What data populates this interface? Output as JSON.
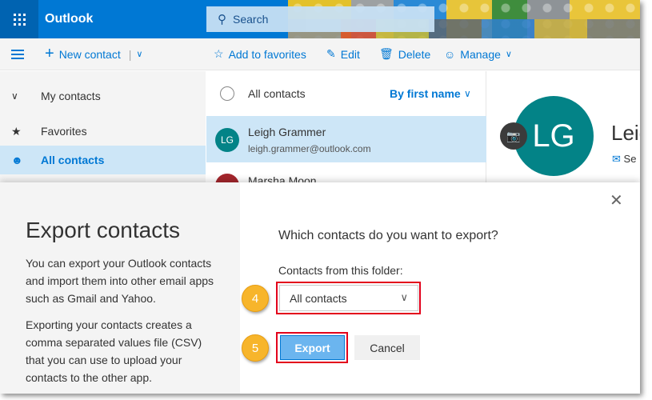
{
  "app": {
    "brand": "Outlook"
  },
  "search": {
    "placeholder": "Search"
  },
  "commandbar": {
    "new_contact": "New contact",
    "add_to_favorites": "Add to favorites",
    "edit": "Edit",
    "delete": "Delete",
    "manage": "Manage"
  },
  "sidebar": {
    "items": [
      {
        "label": "My contacts",
        "icon": "chevron-down-icon"
      },
      {
        "label": "Favorites",
        "icon": "star-icon"
      },
      {
        "label": "All contacts",
        "icon": "person-icon",
        "selected": true
      }
    ]
  },
  "list": {
    "header": "All contacts",
    "sort": "By first name",
    "rows": [
      {
        "initials": "LG",
        "name": "Leigh Grammer",
        "email": "leigh.grammer@outlook.com",
        "color": "#038387",
        "selected": true
      },
      {
        "initials": "",
        "name": "Marsha Moon",
        "email": "",
        "color": "#a4262c"
      }
    ]
  },
  "detail": {
    "initials": "LG",
    "name_partial": "Leig",
    "action_partial": "Se"
  },
  "dialog": {
    "title": "Export contacts",
    "paragraph1": "You can export your Outlook contacts and import them into other email apps such as Gmail and Yahoo.",
    "paragraph2": "Exporting your contacts creates a comma separated values file (CSV) that you can use to upload your contacts to the other app.",
    "question": "Which contacts do you want to export?",
    "folder_label": "Contacts from this folder:",
    "folder_value": "All contacts",
    "export_label": "Export",
    "cancel_label": "Cancel",
    "close_icon": "close-icon"
  },
  "callouts": [
    {
      "number": "4"
    },
    {
      "number": "5"
    }
  ],
  "colors": {
    "accent": "#0078d4",
    "highlight": "#e3001b",
    "callout": "#f7b52b"
  }
}
